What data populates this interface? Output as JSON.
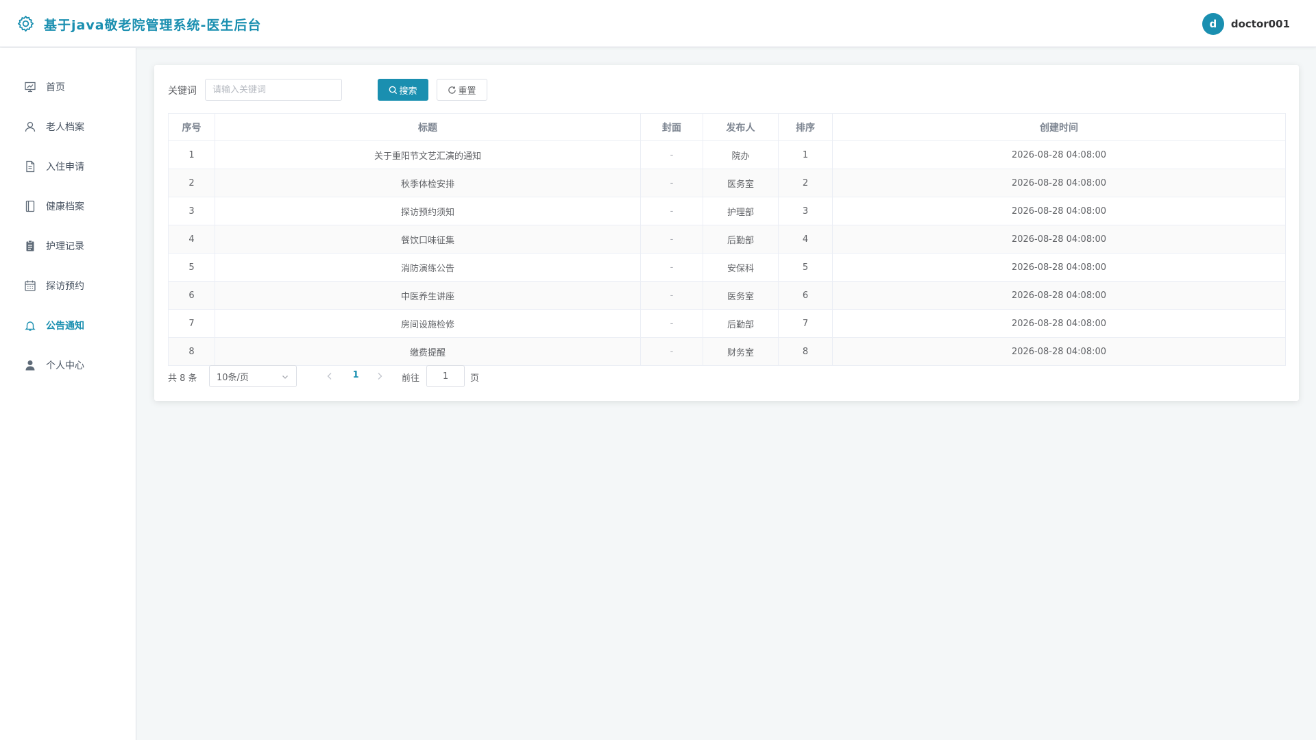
{
  "header": {
    "title": "基于java敬老院管理系统-医生后台",
    "avatar_letter": "d",
    "username": "doctor001"
  },
  "sidebar": {
    "items": [
      {
        "label": "首页",
        "icon": "presentation-chart-icon"
      },
      {
        "label": "老人档案",
        "icon": "user-outline-icon"
      },
      {
        "label": "入住申请",
        "icon": "document-icon"
      },
      {
        "label": "健康档案",
        "icon": "notebook-icon"
      },
      {
        "label": "护理记录",
        "icon": "clipboard-icon"
      },
      {
        "label": "探访预约",
        "icon": "calendar-icon"
      },
      {
        "label": "公告通知",
        "icon": "bell-icon",
        "active": true
      },
      {
        "label": "个人中心",
        "icon": "user-filled-icon"
      }
    ]
  },
  "search": {
    "label": "关键词",
    "placeholder": "请输入关键词",
    "search_label": "搜索",
    "reset_label": "重置"
  },
  "table": {
    "headers": [
      "序号",
      "标题",
      "封面",
      "发布人",
      "排序",
      "创建时间"
    ],
    "rows": [
      [
        "1",
        "关于重阳节文艺汇演的通知",
        "-",
        "院办",
        "1",
        "2026-08-28 04:08:00"
      ],
      [
        "2",
        "秋季体检安排",
        "-",
        "医务室",
        "2",
        "2026-08-28 04:08:00"
      ],
      [
        "3",
        "探访预约须知",
        "-",
        "护理部",
        "3",
        "2026-08-28 04:08:00"
      ],
      [
        "4",
        "餐饮口味征集",
        "-",
        "后勤部",
        "4",
        "2026-08-28 04:08:00"
      ],
      [
        "5",
        "消防演练公告",
        "-",
        "安保科",
        "5",
        "2026-08-28 04:08:00"
      ],
      [
        "6",
        "中医养生讲座",
        "-",
        "医务室",
        "6",
        "2026-08-28 04:08:00"
      ],
      [
        "7",
        "房间设施检修",
        "-",
        "后勤部",
        "7",
        "2026-08-28 04:08:00"
      ],
      [
        "8",
        "缴费提醒",
        "-",
        "财务室",
        "8",
        "2026-08-28 04:08:00"
      ]
    ]
  },
  "pagination": {
    "total_text": "共 8 条",
    "page_size": "10条/页",
    "current_page": "1",
    "goto_label": "前往",
    "goto_value": "1",
    "page_suffix": "页"
  },
  "colors": {
    "accent": "#1a8fb0",
    "background": "#f4f7f8"
  }
}
